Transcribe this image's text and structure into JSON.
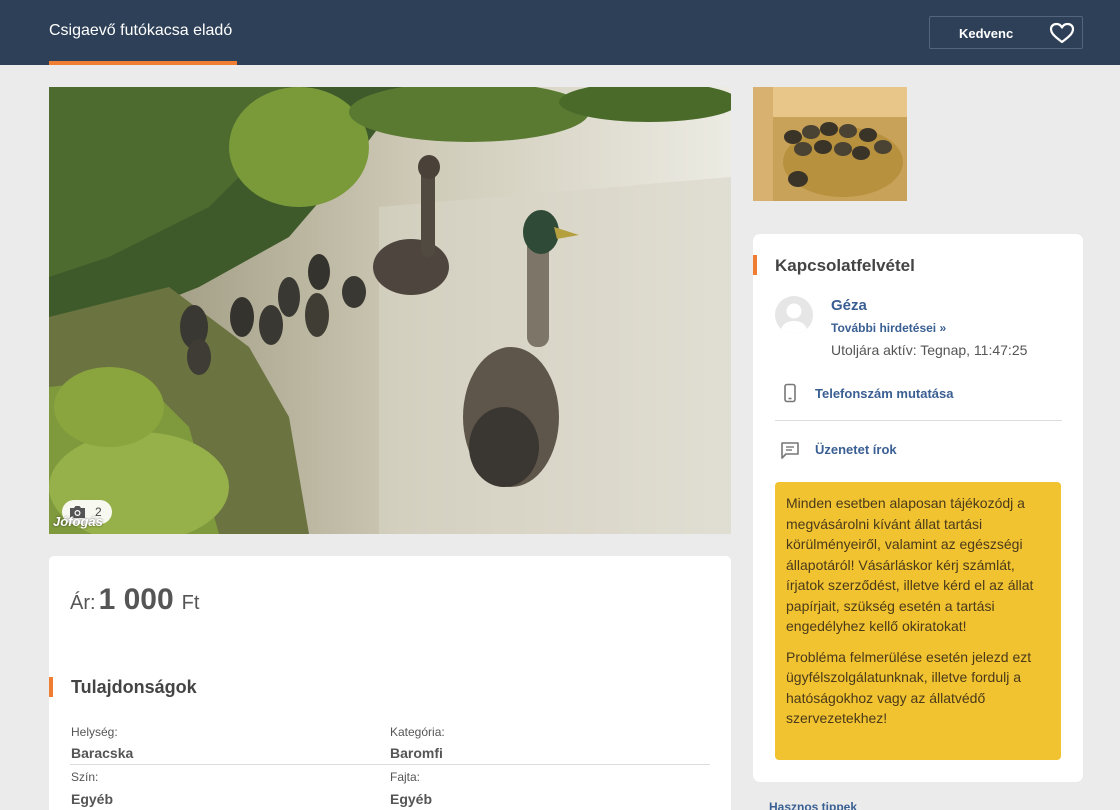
{
  "header": {
    "title": "Csigaevő futókacsa eladó",
    "favorite_label": "Kedvenc"
  },
  "gallery": {
    "photo_count": "2",
    "watermark": "Jófogás"
  },
  "price": {
    "label": "Ár:",
    "value": "1 000",
    "currency": "Ft"
  },
  "properties": {
    "title": "Tulajdonságok",
    "items": [
      {
        "label": "Helység:",
        "value": "Baracska"
      },
      {
        "label": "Kategória:",
        "value": "Baromfi"
      },
      {
        "label": "Szín:",
        "value": "Egyéb"
      },
      {
        "label": "Fajta:",
        "value": "Egyéb"
      }
    ]
  },
  "contact": {
    "title": "Kapcsolatfelvétel",
    "seller_name": "Géza",
    "more_ads": "További hirdetései »",
    "last_active": "Utoljára aktív: Tegnap, 11:47:25",
    "phone_label": "Telefonszám mutatása",
    "message_label": "Üzenetet írok"
  },
  "notice": {
    "paragraph1": "Minden esetben alaposan tájékozódj a megvásárolni kívánt állat tartási körülményeiről, valamint az egészségi állapotáról! Vásárláskor kérj számlát, írjatok szerződést, illetve kérd el az állat papírjait, szükség esetén a tartási engedélyhez kellő okiratokat!",
    "paragraph2": "Probléma felmerülése esetén jelezd ezt ügyfélszolgálatunknak, illetve fordulj a hatóságokhoz vagy az állatvédő szervezetekhez!"
  },
  "footer_link": "Hasznos tippek",
  "colors": {
    "header_bg": "#2e4057",
    "accent": "#ef7d32",
    "link": "#3a5f92",
    "notice_bg": "#f2c330"
  }
}
